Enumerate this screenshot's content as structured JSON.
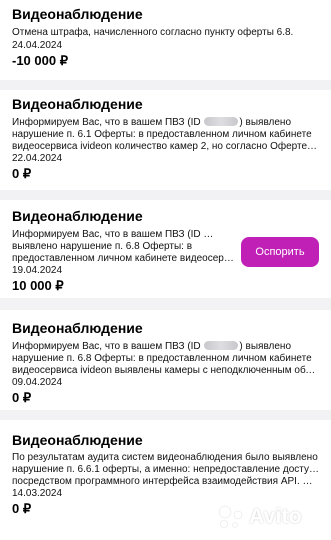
{
  "items": [
    {
      "title": "Видеонаблюдение",
      "line1": "Отмена штрафа, начисленного согласно пункту оферты 6.8.",
      "date": "24.04.2024",
      "amount": "-10 000 ₽"
    },
    {
      "title": "Видеонаблюдение",
      "line1a": "Информируем Вас, что в вашем ПВЗ (ID ",
      "line1b": ") выявлено",
      "line2": "нарушение п. 6.1 Оферты: в предоставленном личном кабинете",
      "line3": "видеосервиса ivideon количество камер 2, но согласно Оферте д…",
      "date": "22.04.2024",
      "amount": "0 ₽"
    },
    {
      "title": "Видеонаблюдение",
      "line1a": "Информируем Вас, что в вашем ПВЗ (ID ",
      "line1b": "",
      "line2": "выявлено нарушение п. 6.8 Оферты: в",
      "line3": "предоставленном личном кабинете видеосерви…",
      "date": "19.04.2024",
      "amount": "10 000 ₽",
      "button": "Оспорить"
    },
    {
      "title": "Видеонаблюдение",
      "line1a": "Информируем Вас, что в вашем ПВЗ (ID ",
      "line1b": ") выявлено",
      "line2": "нарушение п. 6.8 Оферты: в предоставленном личном кабинете",
      "line3": "видеосервиса ivideon выявлены камеры с неподключенным обла…",
      "date": "09.04.2024",
      "amount": "0 ₽"
    },
    {
      "title": "Видеонаблюдение",
      "line1": "По результатам аудита систем видеонаблюдения было выявлено",
      "line2": "нарушение п. 6.6.1 оферты, а именно: непредоставление доступа",
      "line3": "посредством программного интерфейса взаимодействия API. Вы…",
      "date": "14.03.2024",
      "amount": "0 ₽"
    }
  ],
  "watermark": "Avito",
  "colors": {
    "accent": "#c120b7",
    "separator": "#f2f2f4"
  }
}
